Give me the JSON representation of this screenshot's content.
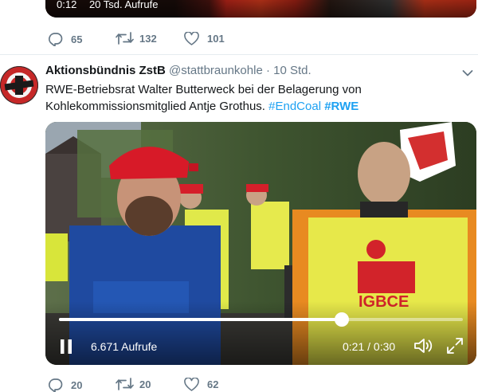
{
  "previous_tweet": {
    "video": {
      "time": "0:12",
      "views": "20 Tsd. Aufrufe"
    },
    "actions": {
      "replies": "65",
      "retweets": "132",
      "likes": "101"
    }
  },
  "tweet": {
    "author_name": "Aktionsbündnis ZstB",
    "author_handle": "@stattbraunkohle",
    "separator": "·",
    "time": "10 Std.",
    "text_part1": "RWE-Betriebsrat Walter Butterweck bei der Belagerung von Kohlekommissionsmitglied Antje Grothus.",
    "hashtag1": "#EndCoal",
    "hashtag2": "#RWE",
    "video": {
      "views": "6.671 Aufrufe",
      "time": "0:21 / 0:30",
      "progress": 0.7,
      "logo_text": "IGBCE"
    },
    "actions": {
      "replies": "20",
      "retweets": "20",
      "likes": "62"
    }
  },
  "colors": {
    "link": "#1da1f2",
    "muted": "#657786",
    "divider": "#e6ecf0"
  }
}
